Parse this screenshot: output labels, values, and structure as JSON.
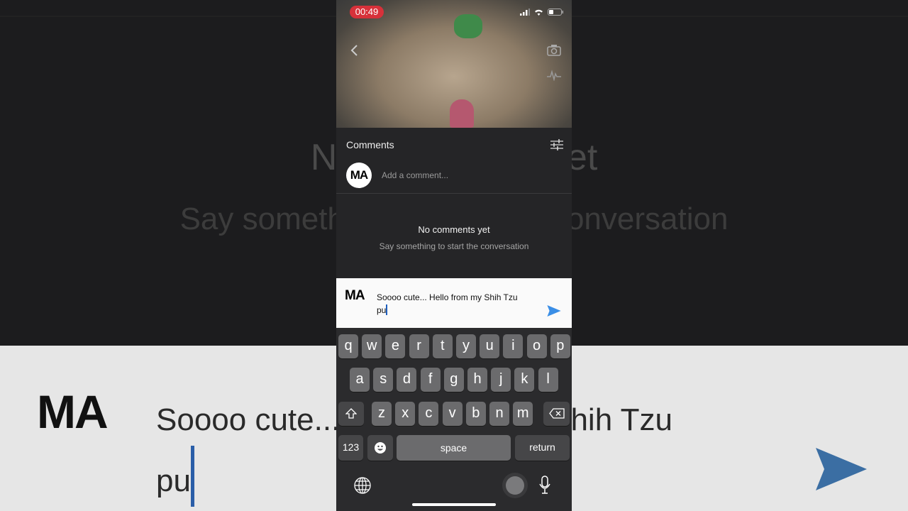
{
  "status_bar": {
    "timer": "00:49"
  },
  "comments": {
    "title": "Comments",
    "avatar_initials": "MA",
    "add_placeholder": "Add a comment...",
    "empty_title": "No comments yet",
    "empty_subtitle": "Say something to start the conversation"
  },
  "composer": {
    "initials": "MA",
    "line1": "Soooo cute... Hello from my Shih Tzu",
    "line2": "pu",
    "send_color": "#3a8ee6"
  },
  "keyboard": {
    "row1": [
      "q",
      "w",
      "e",
      "r",
      "t",
      "y",
      "u",
      "i",
      "o",
      "p"
    ],
    "row2": [
      "a",
      "s",
      "d",
      "f",
      "g",
      "h",
      "j",
      "k",
      "l"
    ],
    "row3": [
      "z",
      "x",
      "c",
      "v",
      "b",
      "n",
      "m"
    ],
    "numbers": "123",
    "space": "space",
    "return": "return"
  },
  "icons": [
    "back-chevron",
    "camera",
    "waveform",
    "signal",
    "wifi",
    "battery",
    "filter-sliders",
    "send-arrow",
    "shift",
    "backspace",
    "emoji",
    "globe",
    "microphone"
  ],
  "colors": {
    "timer": "#d7313a",
    "keyboard_bg": "#2b2b2d",
    "key": "#6b6b6d"
  }
}
